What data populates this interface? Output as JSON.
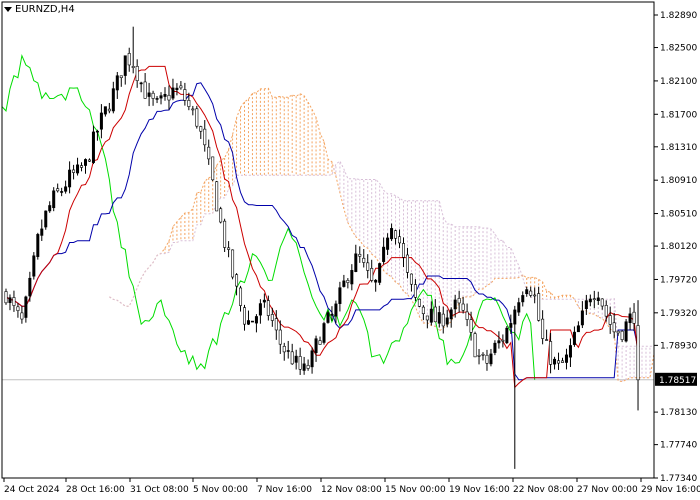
{
  "window": {
    "symbol_label": "EURNZD,H4",
    "menu_icon": "triangle-down-icon"
  },
  "price_axis": {
    "labels": [
      "1.82890",
      "1.82500",
      "1.82100",
      "1.81700",
      "1.81310",
      "1.80910",
      "1.80510",
      "1.80120",
      "1.79720",
      "1.79320",
      "1.78930",
      "1.78130",
      "1.77740",
      "1.77340"
    ],
    "current_price": "1.78517"
  },
  "time_axis": {
    "labels": [
      "24 Oct 2024",
      "28 Oct 16:00",
      "31 Oct 08:00",
      "5 Nov 00:00",
      "7 Nov 16:00",
      "12 Nov 08:00",
      "15 Nov 00:00",
      "19 Nov 16:00",
      "22 Nov 08:00",
      "27 Nov 00:00",
      "29 Nov 16:00"
    ]
  },
  "colors": {
    "background": "#ffffff",
    "frame": "#000000",
    "candle_bull": "#000000",
    "candle_bear": "#ffffff",
    "tenkan": "#cc0000",
    "kijun": "#0000aa",
    "chikou": "#00dd00",
    "cloud_up": "#f4a460",
    "cloud_down": "#d8bfd8",
    "price_line": "#c0c0c0",
    "badge": "#000000"
  },
  "chart_data": {
    "type": "candlestick",
    "indicator": "ichimoku",
    "ylim": [
      1.7734,
      1.8289
    ],
    "x_labels": [
      "24 Oct 2024",
      "28 Oct 16:00",
      "31 Oct 08:00",
      "5 Nov 00:00",
      "7 Nov 16:00",
      "12 Nov 08:00",
      "15 Nov 00:00",
      "19 Nov 16:00",
      "22 Nov 08:00",
      "27 Nov 00:00",
      "29 Nov 16:00"
    ],
    "close_path": [
      1.7955,
      1.7935,
      1.792,
      1.7965,
      1.802,
      1.805,
      1.807,
      1.808,
      1.8095,
      1.81,
      1.811,
      1.814,
      1.8165,
      1.8185,
      1.821,
      1.824,
      1.823,
      1.8205,
      1.8185,
      1.818,
      1.819,
      1.82,
      1.8195,
      1.8175,
      1.816,
      1.812,
      1.808,
      1.803,
      1.799,
      1.795,
      1.792,
      1.7925,
      1.794,
      1.793,
      1.79,
      1.7885,
      1.7875,
      1.786,
      1.787,
      1.79,
      1.792,
      1.793,
      1.796,
      1.7985,
      1.8,
      1.798,
      1.796,
      1.799,
      1.8045,
      1.8025,
      1.798,
      1.795,
      1.7935,
      1.793,
      1.792,
      1.793,
      1.794,
      1.7935,
      1.7905,
      1.788,
      1.787,
      1.789,
      1.79,
      1.792,
      1.795,
      1.797,
      1.7955,
      1.79,
      1.788,
      1.7865,
      1.7875,
      1.79,
      1.7925,
      1.7955,
      1.796,
      1.793,
      1.791,
      1.791,
      1.7925,
      1.7935
    ],
    "current_price": 1.78517
  }
}
